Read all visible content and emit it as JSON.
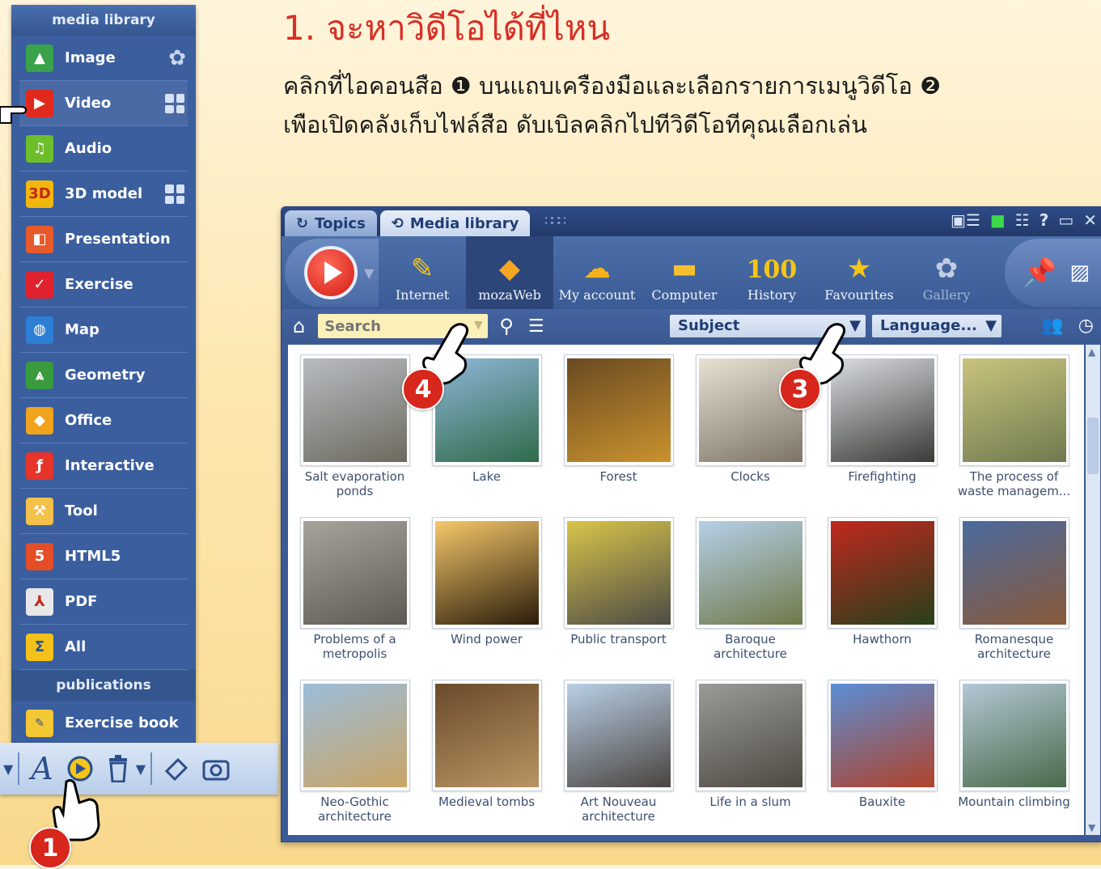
{
  "sidebar": {
    "header": "media library",
    "items": [
      {
        "label": "Image",
        "icon": "image-icon",
        "color": "#39a24a"
      },
      {
        "label": "Video",
        "icon": "video-icon",
        "color": "#e02a1e"
      },
      {
        "label": "Audio",
        "icon": "music-note-icon",
        "color": "#6cbf2a"
      },
      {
        "label": "3D model",
        "icon": "3d-icon",
        "color": "#f2b70c"
      },
      {
        "label": "Presentation",
        "icon": "presentation-icon",
        "color": "#e85a2c"
      },
      {
        "label": "Exercise",
        "icon": "exercise-check-icon",
        "color": "#e0212e"
      },
      {
        "label": "Map",
        "icon": "globe-icon",
        "color": "#2e7ed6"
      },
      {
        "label": "Geometry",
        "icon": "compass-icon",
        "color": "#3a9a3e"
      },
      {
        "label": "Office",
        "icon": "office-diamond-icon",
        "color": "#f0a31c"
      },
      {
        "label": "Interactive",
        "icon": "flash-icon",
        "color": "#e6342a"
      },
      {
        "label": "Tool",
        "icon": "hammer-icon",
        "color": "#f3c14a"
      },
      {
        "label": "HTML5",
        "icon": "html5-icon",
        "color": "#e44d26"
      },
      {
        "label": "PDF",
        "icon": "pdf-icon",
        "color": "#e8e8e8"
      },
      {
        "label": "All",
        "icon": "sigma-icon",
        "color": "#f2c21b"
      }
    ],
    "pub_header": "publications",
    "pub_items": [
      {
        "label": "Exercise book",
        "icon": "exercise-book-icon",
        "color": "#f4c735"
      }
    ]
  },
  "bottom_toolbar": {
    "text_tool": "A",
    "icons": [
      "text-tool-icon",
      "media-library-icon",
      "trash-icon",
      "eraser-icon",
      "camera-icon"
    ]
  },
  "heading": {
    "title": "1. จะหาวิดีโอได้ที่ไหน",
    "line1_a": "คลิกที่ไอคอนสือ",
    "step1": "❶",
    "line1_b": "บนแถบเครืองมือและเลือกรายการเมนูวิดีโอ",
    "step2": "❷",
    "line2": "เพือเปิดคลังเก็บไฟล์สือ ดับเบิลคลิกไปทีวิดีโอทีคุณเลือกเล่น"
  },
  "window": {
    "tabs": [
      "Topics",
      "Media library"
    ],
    "toolbar": [
      {
        "label": "Internet",
        "icon": "internet-icon",
        "glyph": "✎"
      },
      {
        "label": "mozaWeb",
        "icon": "mozaweb-icon",
        "glyph": "◆"
      },
      {
        "label": "My account",
        "icon": "account-cloud-icon",
        "glyph": "☁"
      },
      {
        "label": "Computer",
        "icon": "folder-icon",
        "glyph": "▬"
      },
      {
        "label": "History",
        "icon": "history-100-icon",
        "glyph": "100"
      },
      {
        "label": "Favourites",
        "icon": "star-icon",
        "glyph": "★"
      },
      {
        "label": "Gallery",
        "icon": "gallery-icon",
        "glyph": "✿"
      }
    ],
    "search": {
      "placeholder": "Search"
    },
    "subject": "Subject",
    "language": "Language...",
    "thumbnails": [
      {
        "label": "Salt evaporation ponds",
        "c1": "#b7bcc2",
        "c2": "#6d6a5e"
      },
      {
        "label": "Lake",
        "c1": "#8fb6d8",
        "c2": "#2f6b4a"
      },
      {
        "label": "Forest",
        "c1": "#6b4a22",
        "c2": "#c9922e"
      },
      {
        "label": "Clocks",
        "c1": "#e8e2d4",
        "c2": "#7d7466"
      },
      {
        "label": "Firefighting",
        "c1": "#d9dde2",
        "c2": "#3b3a36"
      },
      {
        "label": "The process of waste managem...",
        "c1": "#c9c47d",
        "c2": "#6f7a4f"
      },
      {
        "label": "Problems of a metropolis",
        "c1": "#a7a49c",
        "c2": "#5d5a54"
      },
      {
        "label": "Wind power",
        "c1": "#f5c76a",
        "c2": "#2b1d0b"
      },
      {
        "label": "Public transport",
        "c1": "#d8c44a",
        "c2": "#4d4b45"
      },
      {
        "label": "Baroque architecture",
        "c1": "#b6cfe8",
        "c2": "#6f7a4a"
      },
      {
        "label": "Hawthorn",
        "c1": "#c0281e",
        "c2": "#27401c"
      },
      {
        "label": "Romanesque architecture",
        "c1": "#4b6a9e",
        "c2": "#8a5a3a"
      },
      {
        "label": "Neo-Gothic architecture",
        "c1": "#9cbcd9",
        "c2": "#c9a566"
      },
      {
        "label": "Medieval tombs",
        "c1": "#6a4a2a",
        "c2": "#b99463"
      },
      {
        "label": "Art Nouveau architecture",
        "c1": "#b9cfe6",
        "c2": "#4a4440"
      },
      {
        "label": "Life in a slum",
        "c1": "#9b9a94",
        "c2": "#4d4a44"
      },
      {
        "label": "Bauxite",
        "c1": "#5a8ed6",
        "c2": "#b0432a"
      },
      {
        "label": "Mountain climbing",
        "c1": "#b4c7d6",
        "c2": "#4a6a4a"
      }
    ]
  },
  "badges": {
    "one": "1",
    "three": "3",
    "four": "4"
  },
  "colors": {
    "accent_red": "#d82e25",
    "panel_blue": "#3a5e9e"
  }
}
